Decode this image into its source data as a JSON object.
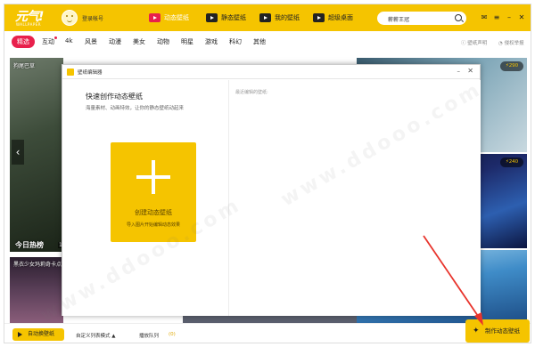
{
  "header": {
    "logo_text": "元气!",
    "logo_sub": "WALLPAPER",
    "login_label": "登录帐号",
    "tabs": [
      {
        "label": "动态壁纸",
        "active": true
      },
      {
        "label": "静态壁纸",
        "active": false
      },
      {
        "label": "我的壁纸",
        "active": false
      },
      {
        "label": "超级桌面",
        "active": false
      }
    ],
    "search_value": "薪薪王冠",
    "win_buttons": [
      "✉",
      "≡",
      "–",
      "✕"
    ]
  },
  "categories": [
    "精选",
    "互动",
    "4k",
    "风景",
    "动漫",
    "美女",
    "动物",
    "明星",
    "游戏",
    "科幻",
    "其他"
  ],
  "active_category": "精选",
  "right_links": [
    "壁纸声明",
    "侵权举报"
  ],
  "cards": {
    "card1_title": "狗尾巴草",
    "card2_title": "今日热榜",
    "card2_badge": "1",
    "card3_title": "黑衣少女玛莉奇卡点",
    "badge_top": "290",
    "badge_mid": "240"
  },
  "modal": {
    "title": "壁纸编辑器",
    "min": "–",
    "close": "✕",
    "heading": "快速创作动态壁纸",
    "subheading": "海量素材、动画特效，让你的静态壁纸动起来",
    "create_label": "创建动态壁纸",
    "create_sub": "导入图片开始编辑动态效果",
    "recent_label": "最近编辑的壁纸:"
  },
  "bottom": {
    "auto_switch": "自动换壁纸",
    "mode": "自定义列表模式 ▲",
    "pause_label": "播放队列",
    "count": "(0)"
  },
  "make_button": "制作动态壁纸",
  "watermark": "www.ddooo.com",
  "colors": {
    "brand": "#f5c400",
    "accent": "#e8204c",
    "arrow": "#e8342c"
  }
}
